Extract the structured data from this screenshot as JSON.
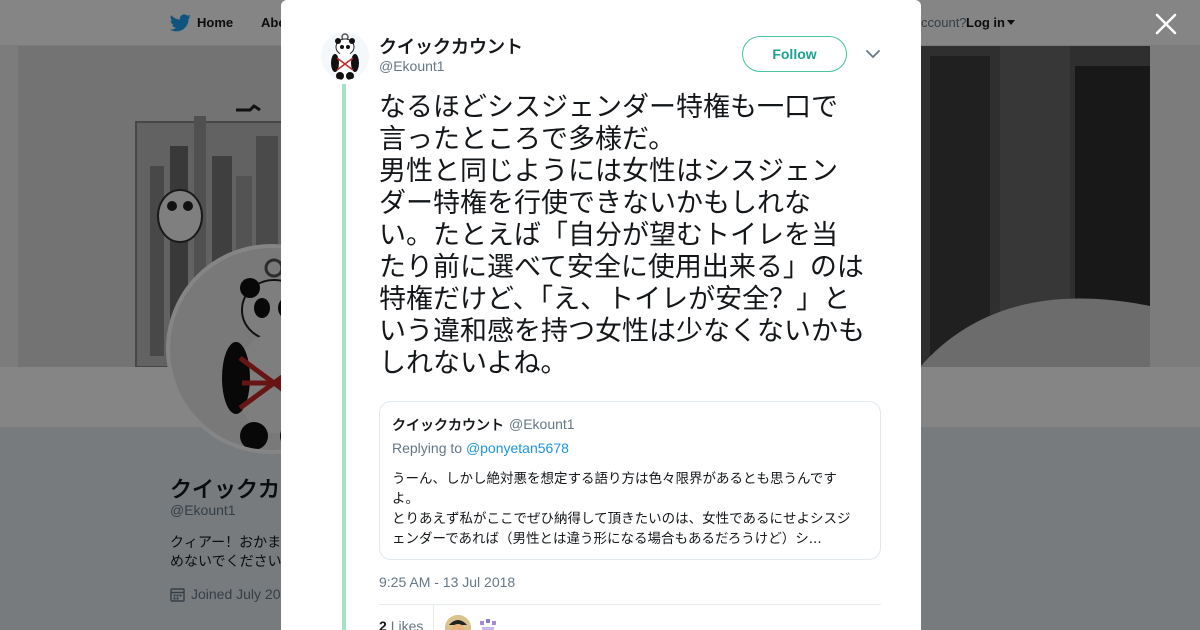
{
  "topbar": {
    "home_label": "Home",
    "about_label": "Abo",
    "account_prompt": "ccount?",
    "login_label": "Log in"
  },
  "profile": {
    "name": "クイックカ",
    "handle": "@Ekount1",
    "bio_line1": "クィアー！おかま",
    "bio_line2": "めないでください",
    "joined": "Joined July 20"
  },
  "tweet": {
    "author_name": "クイックカウント",
    "author_handle": "@Ekount1",
    "follow_label": "Follow",
    "text": "なるほどシスジェンダー特権も一口で\n言ったところで多様だ。\n男性と同じようには女性はシスジェン\nダー特権を行使できないかもしれな\nい。たとえば「自分が望むトイレを当\nたり前に選べて安全に使用出来る」のは\n特権だけど、「え、トイレが安全？」と\nいう違和感を持つ女性は少なくないかも\nしれないよね。",
    "timestamp": "9:25 AM - 13 Jul 2018",
    "likes_count": "2",
    "likes_label": "Likes"
  },
  "quoted": {
    "name": "クイックカウント",
    "handle": "@Ekount1",
    "replying_prefix": "Replying to",
    "replying_to": "@ponyetan5678",
    "text": "うーん、しかし絶対悪を想定する語り方は色々限界があるとも思うんです\nよ。\nとりあえず私がここでぜひ納得して頂きたいのは、女性であるにせよシスジ\nェンダーであれば（男性とは違う形になる場合もあるだろうけど）シ..."
  },
  "colors": {
    "accent": "#1da191",
    "thread_line": "#a3e4c8",
    "link": "#1b95e0",
    "muted": "#657786",
    "text": "#14171a"
  },
  "icons": {
    "brand": "twitter-bird-icon",
    "close": "close-icon",
    "menu": "chevron-down-icon",
    "calendar": "calendar-icon"
  }
}
